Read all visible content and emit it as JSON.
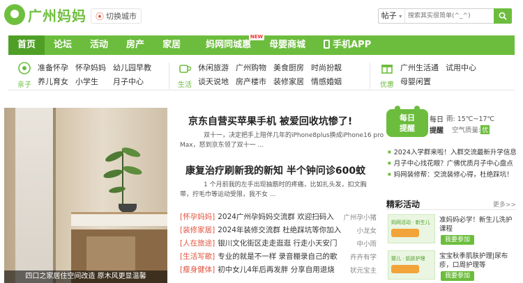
{
  "header": {
    "logo_text": "广州妈妈",
    "city_label": "切换城市",
    "search": {
      "scope": "帖子",
      "placeholder": "搜索其实很简单(^_^)",
      "button_icon": "search-icon"
    }
  },
  "nav": {
    "items": [
      {
        "label": "首页",
        "active": true
      },
      {
        "label": "论坛"
      },
      {
        "label": "活动"
      },
      {
        "label": "房产"
      },
      {
        "label": "家居"
      },
      {
        "label": "妈网同城惠",
        "badge": "NEW"
      },
      {
        "label": "母婴商城"
      },
      {
        "label": "手机APP"
      }
    ]
  },
  "categories": [
    {
      "icon": "baby-icon",
      "label": "亲子",
      "links": [
        "准备怀孕",
        "养儿育女",
        "怀孕妈妈",
        "小学生",
        "幼儿园早教",
        "月子中心"
      ]
    },
    {
      "icon": "cup-icon",
      "label": "生活",
      "links": [
        "休闲旅游",
        "谈天说地",
        "广州购物",
        "房产楼市",
        "美食厨房",
        "装修家居",
        "时尚扮靓",
        "情感婚姻"
      ]
    },
    {
      "icon": "gift-icon",
      "label": "优惠",
      "links": [
        "广州生活通",
        "母婴闲置",
        "试用中心"
      ]
    }
  ],
  "hero": {
    "caption": "四口之家居住空间改造 原木风更显温馨"
  },
  "headlines": [
    {
      "title": "京东自营买苹果手机 被爱回收坑惨了!",
      "summary_1": "双十一，决定把手上陪伴几年的iPhone8plus换成iPhone16 pro",
      "summary_2": "Max，怒到京东领了双十一 ..."
    },
    {
      "title": "康复治疗刷新我的新知 半个钟问诊600蚊",
      "summary_1": "1 个月前我的左手出现抽筋时的疼痛，比如扎头发，扣文胸",
      "summary_2": "带，拧毛巾等运动受限，我不女 ..."
    }
  ],
  "news_list": [
    {
      "tag": "[怀孕妈妈]",
      "text": "2024广州孕妈妈交流群 欢迎扫码入",
      "source": "广州孕小猪"
    },
    {
      "tag": "[装修家居]",
      "text": "2024年装修交流群 杜绝踩坑等你加入",
      "source": "小龙女"
    },
    {
      "tag": "[人在旅途]",
      "text": "银川文化街区走走逛逛 行走小天安门",
      "source": "中小雨"
    },
    {
      "tag": "[生活写歌]",
      "text": "专业的就是不一样 录音棚录自己的歌",
      "source": "卉卉有学"
    },
    {
      "tag": "[瘦身健体]",
      "text": "初中女儿4年后再发胖 分享自用退烧",
      "source": "状元宝主"
    }
  ],
  "daily": {
    "line1": "每日",
    "line2": "提醒"
  },
  "weather": {
    "w1": "每日",
    "w1b": "雨: 15℃~17℃",
    "w2": "提醒",
    "w2b_label": "空气质量:",
    "aq": "优"
  },
  "right_links": [
    "2024入学群来啦！入群交流最新升学信息",
    "月子中心找花眼？广佛优质月子中心盘点",
    "妈网装修帮：交流装修心得，杜绝踩坑！"
  ],
  "activities": {
    "title": "精彩活动",
    "more": "更多>>",
    "items": [
      {
        "thumb_text": "妈网活动 · 新生儿",
        "title": "准妈妈必学！新生儿洗护课程",
        "join": "我要参加"
      },
      {
        "thumb_text": "婴儿 · 肌肤护理",
        "title": "宝宝秋季肌肤护理|尿布疹，口周护理等",
        "join": "我要参加"
      }
    ]
  },
  "colors": {
    "brand_green": "#6cbd3d",
    "nav_active": "#4f9f27",
    "tag_red": "#e0533e"
  }
}
